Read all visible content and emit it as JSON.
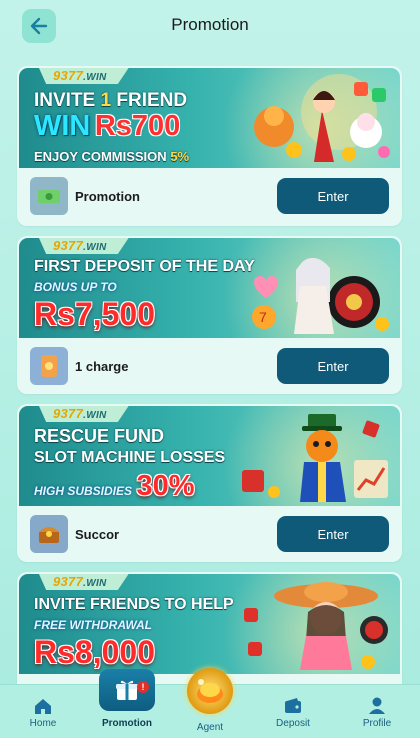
{
  "header": {
    "title": "Promotion"
  },
  "cards": [
    {
      "brand": "9377",
      "brand_suffix": ".WIN",
      "line1_a": "INVITE",
      "line1_num": "1",
      "line1_b": "FRIEND",
      "win_word": "WIN",
      "win_amount": "Rs700",
      "line3_a": "ENJOY COMMISSION",
      "line3_pct": "5%",
      "label": "Promotion",
      "button": "Enter"
    },
    {
      "brand": "9377",
      "brand_suffix": ".WIN",
      "line1": "FIRST DEPOSIT OF THE DAY",
      "line2": "BONUS UP TO",
      "amount": "Rs7,500",
      "label": "1 charge",
      "button": "Enter"
    },
    {
      "brand": "9377",
      "brand_suffix": ".WIN",
      "line1": "RESCUE FUND",
      "line2": "SLOT MACHINE LOSSES",
      "line3": "HIGH SUBSIDIES",
      "pct": "30%",
      "label": "Succor",
      "button": "Enter"
    },
    {
      "brand": "9377",
      "brand_suffix": ".WIN",
      "line1": "INVITE FRIENDS TO HELP",
      "line2": "FREE WITHDRAWAL",
      "amount": "Rs8,000"
    }
  ],
  "nav": {
    "home": "Home",
    "promotion": "Promotion",
    "agent": "Agent",
    "deposit": "Deposit",
    "profile": "Profile",
    "promotion_badge": "!"
  },
  "colors": {
    "accent": "#0f5a78",
    "background": "#a8eadf",
    "highlight": "#ffd84a",
    "amount_red": "#ff2a2a"
  },
  "icons": {
    "back": "arrow-left-icon",
    "home": "home-icon",
    "promotion": "gift-icon",
    "agent": "agent-gold-icon",
    "deposit": "wallet-icon",
    "profile": "user-icon"
  }
}
